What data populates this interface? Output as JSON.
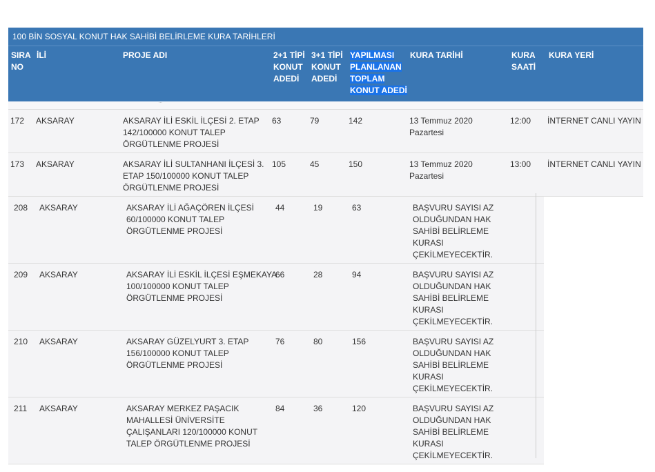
{
  "title": "100 BİN SOSYAL KONUT HAK SAHİBİ BELİRLEME KURA TARİHLERİ",
  "columns": {
    "sira_no_1": "SIRA",
    "sira_no_2": "NO",
    "il": "İLİ",
    "proje": "PROJE ADI",
    "tip21_1": "2+1 TİPİ",
    "tip21_2": "KONUT",
    "tip21_3": "ADEDİ",
    "tip31_1": "3+1 TİPİ",
    "tip31_2": "KONUT",
    "tip31_3": "ADEDİ",
    "toplam_1": "YAPILMASI",
    "toplam_2": "PLANLANAN",
    "toplam_3": "TOPLAM",
    "toplam_4": "KONUT ADEDİ",
    "kura_tarihi": "KURA TARİHİ",
    "kura_saati_1": "KURA",
    "kura_saati_2": "SAATİ",
    "kura_yeri": "KURA YERİ"
  },
  "strip_text": "...",
  "rows": [
    {
      "no": "172",
      "il": "AKSARAY",
      "proje_lines": [
        "AKSARAY İLİ ESKİL İLÇESİ 2. ETAP",
        "142/100000 KONUT TALEP",
        "ÖRGÜTLENME PROJESİ"
      ],
      "t21": "63",
      "t31": "79",
      "toplam": "142",
      "tarih_lines": [
        "13 Temmuz 2020",
        "Pazartesi"
      ],
      "saat": "12:00",
      "yer": "İNTERNET CANLI YAYIN"
    },
    {
      "no": "173",
      "il": "AKSARAY",
      "proje_lines": [
        "AKSARAY İLİ SULTANHANI İLÇESİ 3.",
        "ETAP 150/100000 KONUT TALEP",
        "ÖRGÜTLENME PROJESİ"
      ],
      "t21": "105",
      "t31": "45",
      "toplam": "150",
      "tarih_lines": [
        "13 Temmuz 2020",
        "Pazartesi"
      ],
      "saat": "13:00",
      "yer": "İNTERNET CANLI YAYIN"
    },
    {
      "no": "208",
      "il": "AKSARAY",
      "proje_lines": [
        "AKSARAY İLİ AĞAÇÖREN İLÇESİ",
        "60/100000 KONUT TALEP",
        "ÖRGÜTLENME PROJESİ"
      ],
      "t21": "44",
      "t31": "19",
      "toplam": "63",
      "not_lines": [
        "BAŞVURU SAYISI AZ",
        "OLDUĞUNDAN HAK",
        "SAHİBİ BELİRLEME",
        "KURASI",
        "ÇEKİLMEYECEKTİR."
      ]
    },
    {
      "no": "209",
      "il": "AKSARAY",
      "proje_lines": [
        "AKSARAY İLİ ESKİL İLÇESİ EŞMEKAYA",
        "100/100000 KONUT TALEP",
        "ÖRGÜTLENME PROJESİ"
      ],
      "t21": "66",
      "t31": "28",
      "toplam": "94",
      "not_lines": [
        "BAŞVURU SAYISI AZ",
        "OLDUĞUNDAN HAK",
        "SAHİBİ BELİRLEME",
        "KURASI",
        "ÇEKİLMEYECEKTİR."
      ]
    },
    {
      "no": "210",
      "il": "AKSARAY",
      "proje_lines": [
        "AKSARAY GÜZELYURT 3. ETAP",
        "156/100000 KONUT TALEP",
        "ÖRGÜTLENME PROJESİ"
      ],
      "t21": "76",
      "t31": "80",
      "toplam": "156",
      "not_lines": [
        "BAŞVURU SAYISI AZ",
        "OLDUĞUNDAN HAK",
        "SAHİBİ BELİRLEME",
        "KURASI",
        "ÇEKİLMEYECEKTİR."
      ]
    },
    {
      "no": "211",
      "il": "AKSARAY",
      "proje_lines": [
        "AKSARAY MERKEZ PAŞACIK",
        "MAHALLESİ ÜNİVERSİTE",
        "ÇALIŞANLARI 120/100000 KONUT",
        "TALEP ÖRGÜTLENME PROJESİ"
      ],
      "t21": "84",
      "t31": "36",
      "toplam": "120",
      "not_lines": [
        "BAŞVURU SAYISI AZ",
        "OLDUĞUNDAN HAK",
        "SAHİBİ BELİRLEME",
        "KURASI",
        "ÇEKİLMEYECEKTİR."
      ]
    }
  ]
}
